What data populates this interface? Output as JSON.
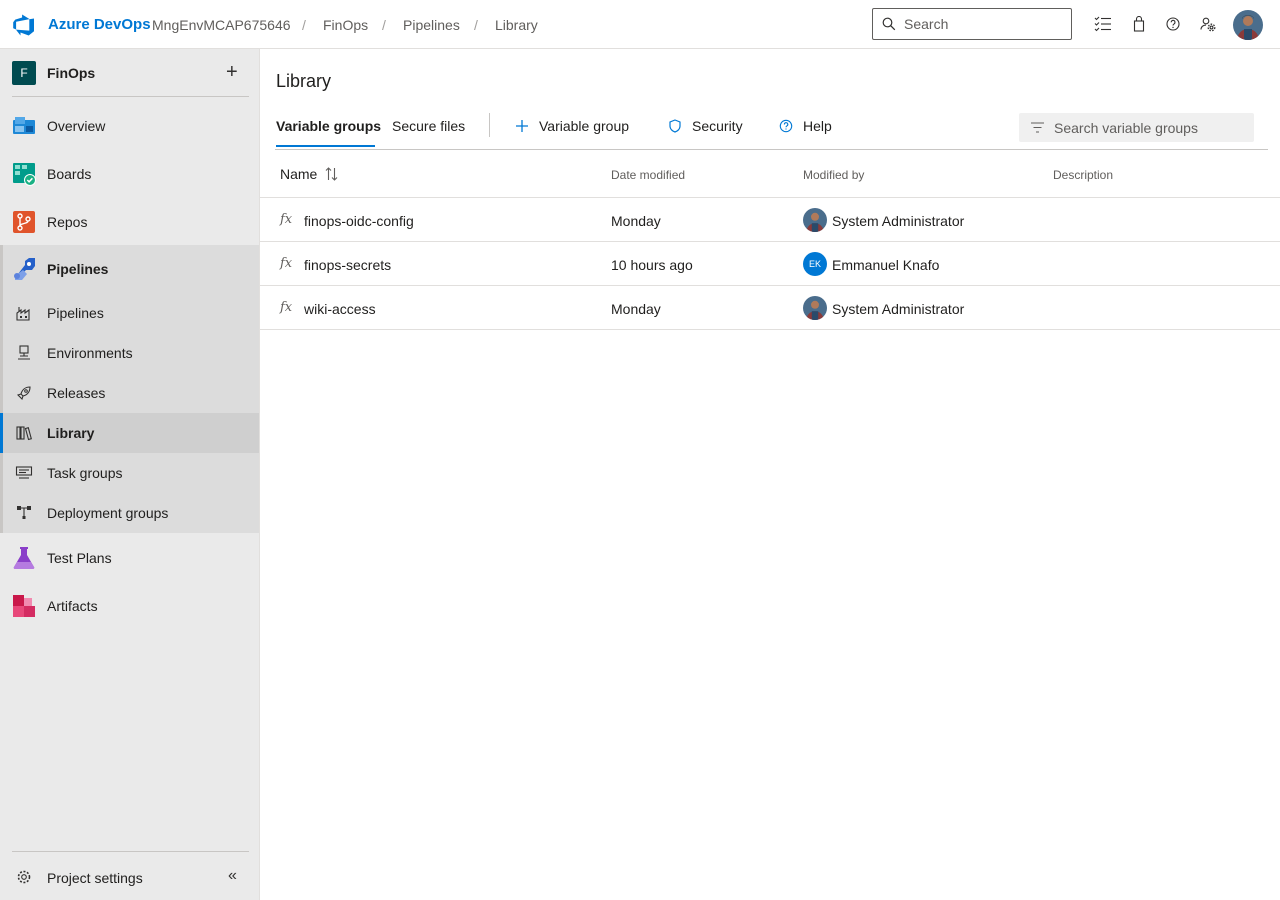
{
  "topbar": {
    "brand": "Azure DevOps",
    "breadcrumb": [
      "MngEnvMCAP675646",
      "FinOps",
      "Pipelines",
      "Library"
    ],
    "search_placeholder": "Search"
  },
  "sidebar": {
    "project_initial": "F",
    "project_name": "FinOps",
    "items": [
      {
        "label": "Overview"
      },
      {
        "label": "Boards"
      },
      {
        "label": "Repos"
      },
      {
        "label": "Pipelines"
      },
      {
        "label": "Test Plans"
      },
      {
        "label": "Artifacts"
      }
    ],
    "pipeline_sub_items": [
      {
        "label": "Pipelines"
      },
      {
        "label": "Environments"
      },
      {
        "label": "Releases"
      },
      {
        "label": "Library"
      },
      {
        "label": "Task groups"
      },
      {
        "label": "Deployment groups"
      }
    ],
    "project_settings": "Project settings"
  },
  "main": {
    "title": "Library",
    "tabs": [
      {
        "label": "Variable groups"
      },
      {
        "label": "Secure files"
      }
    ],
    "commands": {
      "add_variable_group": "Variable group",
      "security": "Security",
      "help": "Help"
    },
    "filter_placeholder": "Search variable groups",
    "columns": {
      "name": "Name",
      "date_modified": "Date modified",
      "modified_by": "Modified by",
      "description": "Description"
    },
    "rows": [
      {
        "name": "finops-oidc-config",
        "date": "Monday",
        "modified_by": "System Administrator",
        "description": ""
      },
      {
        "name": "finops-secrets",
        "date": "10 hours ago",
        "modified_by": "Emmanuel Knafo",
        "initials": "EK",
        "description": ""
      },
      {
        "name": "wiki-access",
        "date": "Monday",
        "modified_by": "System Administrator",
        "description": ""
      }
    ],
    "fx_symbol": "fx"
  },
  "colors": {
    "accent": "#0078d4",
    "sidebar_bg": "#eaeaea",
    "group_bg": "#dcdcdc"
  }
}
